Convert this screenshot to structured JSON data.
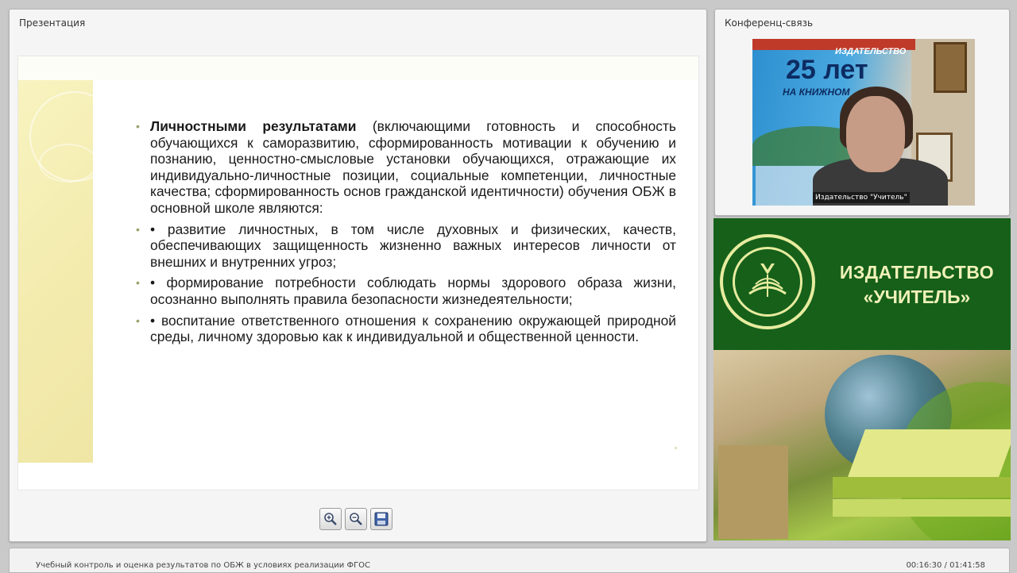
{
  "presentation_panel": {
    "title": "Презентация"
  },
  "conference_panel": {
    "title": "Конференц-связь",
    "video": {
      "participant_label": "Издательство \"Учитель\"",
      "banner_25": "25 лет",
      "banner_na": "НА КНИЖНОМ",
      "banner_izd": "ИЗДАТЕЛЬСТВО"
    }
  },
  "slide": {
    "paragraph": {
      "bold_lead": "Личностными результатами",
      "rest": " (включающими готовность и способность обучающихся к саморазвитию, сформированность мотивации к обучению и познанию, ценностно-смысловые установки обучающихся, отражающие их индивидуально-личностные позиции, социальные компетенции, личностные качества; сформированность основ гражданской идентичности) обучения ОБЖ в основной школе являются:"
    },
    "items": [
      "• развитие личностных, в том числе духовных и физических, качеств, обеспечивающих защищенность жизненно важных интересов личности от внешних и внутренних угроз;",
      "• формирование потребности соблюдать нормы здорового образа жизни, осознанно выполнять правила безопасности жизнедеятельности;",
      "• воспитание ответственного отношения к сохранению окружающей природной среды, личному здоровью как к индивидуальной и общественной ценности."
    ],
    "bullet": "•"
  },
  "toolbar": {
    "zoom_in_icon": "zoom-in-icon",
    "zoom_out_icon": "zoom-out-icon",
    "save_icon": "save-icon"
  },
  "brand": {
    "line1": "ИЗДАТЕЛЬСТВО",
    "line2": "«УЧИТЕЛЬ»"
  },
  "footer": {
    "title": "Учебный контроль и оценка результатов по ОБЖ в условиях реализации ФГОС",
    "time": "00:16:30 / 01:41:58"
  },
  "colors": {
    "brand_green": "#16601a",
    "brand_text": "#f0f1b8",
    "slide_accent": "#f3ebad"
  }
}
